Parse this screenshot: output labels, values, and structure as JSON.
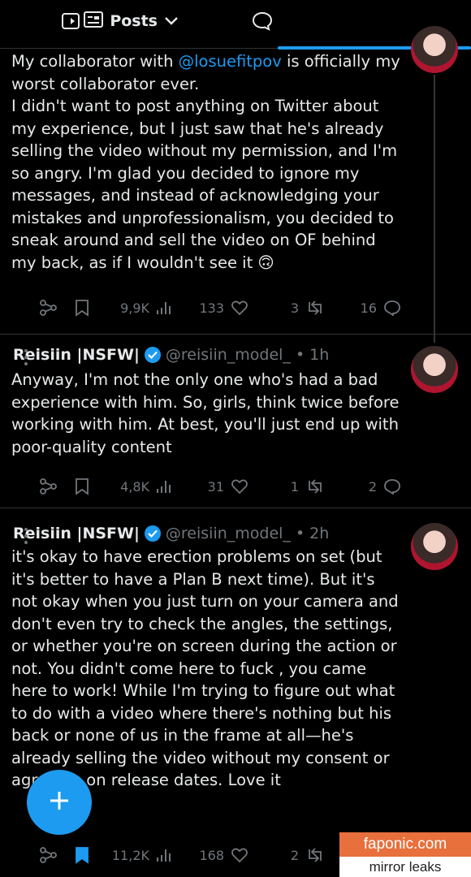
{
  "topbar": {
    "tab_label": "Posts",
    "icons": [
      "back-icon",
      "chat-bubble-icon",
      "chevron-down-icon",
      "news-icon"
    ],
    "accent": "#1d9bf0"
  },
  "posts": [
    {
      "name": "",
      "handle": "",
      "time": "",
      "text_before_mention": "My collaborator with ",
      "mention": "@losuefitpov",
      "text_after_mention": " is officially my worst collaborator ever.\nI didn't want to post anything on Twitter about my experience, but I just saw that he's already selling the video without my permission, and I'm so angry. I'm glad you decided to ignore my messages, and instead of acknowledging your mistakes and unprofessionalism, you decided to sneak around and sell the video on OF behind my back, as if I wouldn't see it 🙃",
      "replies": "16",
      "reposts": "3",
      "likes": "133",
      "views": "9,9K",
      "bookmarked": false
    },
    {
      "name": "Reisiin |NSFW|",
      "handle": "@reisiin_model_",
      "dot": "•",
      "time": "1h",
      "text": "Anyway, I'm not the only one who's had a bad experience with him. So, girls, think twice before working with him. At best, you'll just end up with poor-quality content",
      "replies": "2",
      "reposts": "1",
      "likes": "31",
      "views": "4,8K",
      "bookmarked": false
    },
    {
      "name": "Reisiin |NSFW|",
      "handle": "@reisiin_model_",
      "dot": "•",
      "time": "2h",
      "text": "it's okay to have erection problems on set (but it's better to have a Plan B next time). But it's not okay when you just turn on your camera and don't even try to check the angles, the settings, or whether you're on screen during the action or not. You didn't come here to fuck , you came here to work! While I'm trying to figure out what to do with a video where there's nothing but his back or none of us in the frame at all—he's already selling the video without my consent or agreeing on release dates. Love it",
      "replies": "2",
      "reposts": "2",
      "likes": "168",
      "views": "11,2K",
      "bookmarked": true
    }
  ],
  "fab": {
    "icon": "plus-icon"
  },
  "watermark": {
    "line1": "faponic.com",
    "line2": "mirror leaks"
  }
}
